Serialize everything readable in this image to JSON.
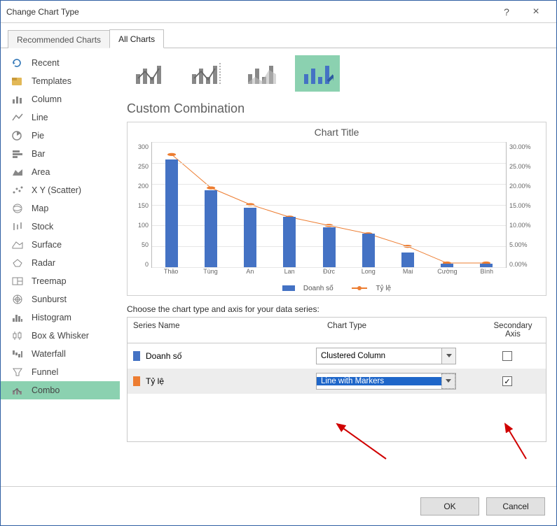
{
  "window": {
    "title": "Change Chart Type",
    "help_label": "?",
    "close_label": "×"
  },
  "tabs": {
    "recommended": "Recommended Charts",
    "all": "All Charts"
  },
  "chart_types": [
    {
      "icon": "recent",
      "label": "Recent"
    },
    {
      "icon": "templates",
      "label": "Templates"
    },
    {
      "icon": "column",
      "label": "Column"
    },
    {
      "icon": "line",
      "label": "Line"
    },
    {
      "icon": "pie",
      "label": "Pie"
    },
    {
      "icon": "bar",
      "label": "Bar"
    },
    {
      "icon": "area",
      "label": "Area"
    },
    {
      "icon": "scatter",
      "label": "X Y (Scatter)"
    },
    {
      "icon": "map",
      "label": "Map"
    },
    {
      "icon": "stock",
      "label": "Stock"
    },
    {
      "icon": "surface",
      "label": "Surface"
    },
    {
      "icon": "radar",
      "label": "Radar"
    },
    {
      "icon": "treemap",
      "label": "Treemap"
    },
    {
      "icon": "sunburst",
      "label": "Sunburst"
    },
    {
      "icon": "histogram",
      "label": "Histogram"
    },
    {
      "icon": "boxwhisker",
      "label": "Box & Whisker"
    },
    {
      "icon": "waterfall",
      "label": "Waterfall"
    },
    {
      "icon": "funnel",
      "label": "Funnel"
    },
    {
      "icon": "combo",
      "label": "Combo"
    }
  ],
  "selected_type_index": 18,
  "heading": "Custom Combination",
  "preview_title": "Chart Title",
  "legend": {
    "s1": "Doanh số",
    "s2": "Tỷ lệ"
  },
  "y_left_ticks": [
    "300",
    "250",
    "200",
    "150",
    "100",
    "50",
    "0"
  ],
  "y_right_ticks": [
    "30.00%",
    "25.00%",
    "20.00%",
    "15.00%",
    "10.00%",
    "5.00%",
    "0.00%"
  ],
  "instruction": "Choose the chart type and axis for your data series:",
  "table_headers": {
    "name": "Series Name",
    "type": "Chart Type",
    "secondary": "Secondary Axis"
  },
  "series_rows": [
    {
      "color": "#4472c4",
      "name": "Doanh số",
      "type": "Clustered Column",
      "secondary": false,
      "highlighted": false
    },
    {
      "color": "#ed7d31",
      "name": "Tỷ lệ",
      "type": "Line with Markers",
      "secondary": true,
      "highlighted": true
    }
  ],
  "buttons": {
    "ok": "OK",
    "cancel": "Cancel"
  },
  "chart_data": {
    "type": "bar",
    "title": "Chart Title",
    "categories": [
      "Thảo",
      "Tùng",
      "An",
      "Lan",
      "Đức",
      "Long",
      "Mai",
      "Cường",
      "Bình"
    ],
    "series": [
      {
        "name": "Doanh số",
        "type": "column",
        "axis": "primary",
        "color": "#4472c4",
        "values": [
          258,
          185,
          143,
          120,
          96,
          80,
          35,
          8,
          8
        ]
      },
      {
        "name": "Tỷ lệ",
        "type": "line_marker",
        "axis": "secondary",
        "color": "#ed7d31",
        "values": [
          0.27,
          0.19,
          0.15,
          0.12,
          0.1,
          0.08,
          0.05,
          0.01,
          0.01
        ]
      }
    ],
    "ylim_primary": [
      0,
      300
    ],
    "ylim_secondary": [
      0,
      0.3
    ],
    "xlabel": "",
    "ylabel": ""
  }
}
